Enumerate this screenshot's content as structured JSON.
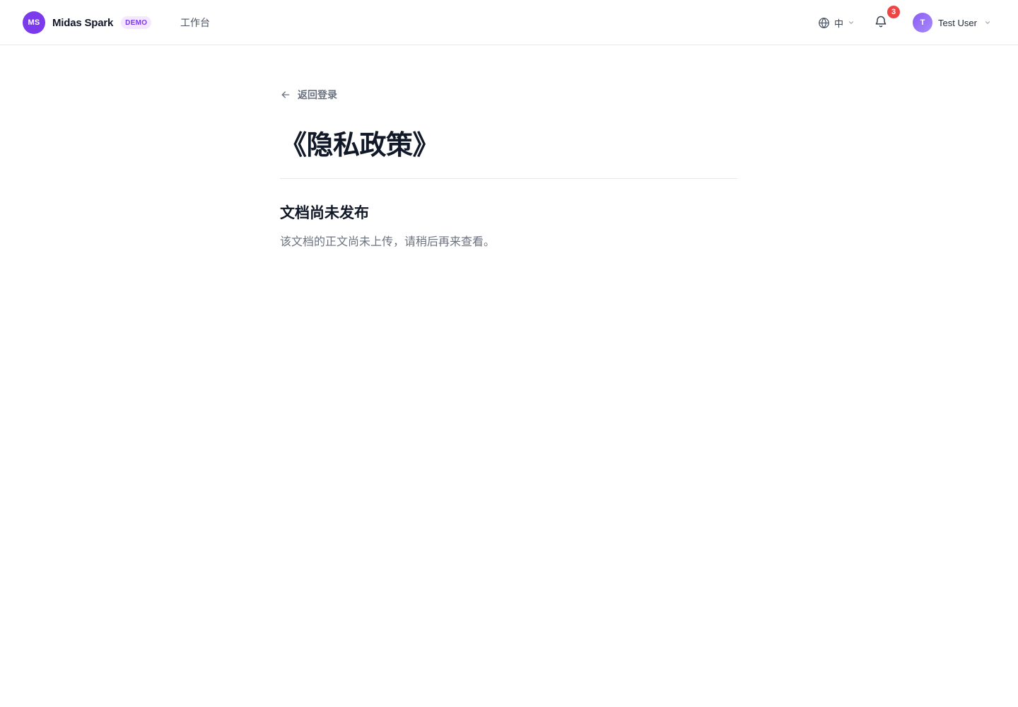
{
  "header": {
    "brand": {
      "logo_text": "MS",
      "name": "Midas Spark",
      "badge": "DEMO"
    },
    "nav": {
      "workbench_label": "工作台"
    },
    "language": {
      "current": "中",
      "icon": "globe-icon"
    },
    "notifications": {
      "icon": "bell-icon",
      "count": "3"
    },
    "user": {
      "avatar_initial": "T",
      "name": "Test User"
    }
  },
  "main": {
    "back_label": "返回登录",
    "title": "《隐私政策》",
    "notice": {
      "heading": "文档尚未发布",
      "body": "该文档的正文尚未上传，请稍后再来查看。"
    }
  },
  "colors": {
    "brand_purple": "#7c3aed",
    "badge_bg": "#f3e8ff",
    "notification_red": "#ef4444",
    "text_primary": "#111827",
    "text_muted": "#6b7280",
    "divider": "#e5e7eb"
  }
}
